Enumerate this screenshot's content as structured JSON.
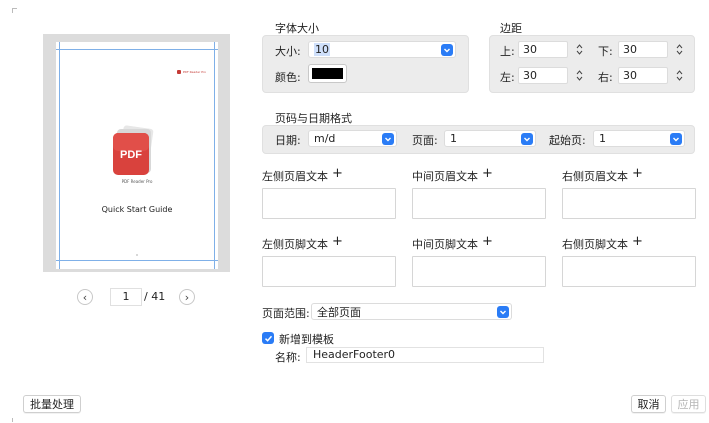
{
  "preview": {
    "brand": "PDF Reader Pro",
    "app_name": "PDF Reader Pro",
    "pdf_badge": "PDF",
    "doc_title": "Quick Start Guide",
    "current_page": "1",
    "total_pages": "/ 41",
    "prev_glyph": "‹",
    "next_glyph": "›"
  },
  "font_size": {
    "title": "字体大小",
    "size_label": "大小:",
    "size_value": "10",
    "color_label": "颜色:",
    "color_value": "#000000"
  },
  "margins": {
    "title": "边距",
    "top_label": "上:",
    "top_value": "30",
    "bottom_label": "下:",
    "bottom_value": "30",
    "left_label": "左:",
    "left_value": "30",
    "right_label": "右:",
    "right_value": "30"
  },
  "page_date": {
    "title": "页码与日期格式",
    "date_label": "日期:",
    "date_value": "m/d",
    "page_label": "页面:",
    "page_value": "1",
    "start_label": "起始页:",
    "start_value": "1"
  },
  "header_text": {
    "left": "左侧页眉文本",
    "center": "中间页眉文本",
    "right": "右侧页眉文本",
    "add": "+"
  },
  "footer_text": {
    "left": "左侧页脚文本",
    "center": "中间页脚文本",
    "right": "右侧页脚文本",
    "add": "+"
  },
  "page_range": {
    "label": "页面范围:",
    "value": "全部页面"
  },
  "template": {
    "checkbox_label": "新增到模板",
    "checked": true,
    "name_label": "名称:",
    "name_value": "HeaderFooter0"
  },
  "buttons": {
    "batch": "批量处理",
    "cancel": "取消",
    "apply": "应用"
  },
  "colors": {
    "accent": "#2a7cf6",
    "pdf_red": "#c43b36",
    "group_bg": "#ececec"
  }
}
